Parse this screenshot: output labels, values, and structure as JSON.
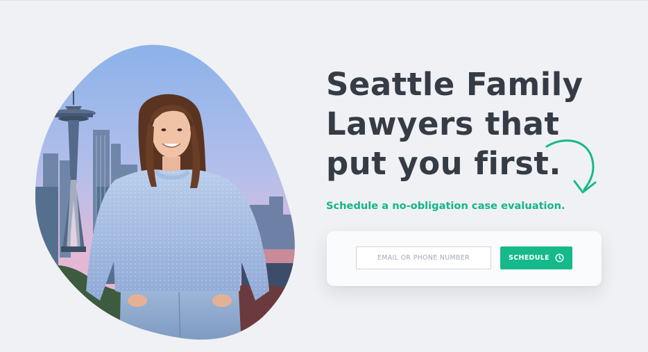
{
  "hero": {
    "headline_lines": [
      "Seattle Family",
      "Lawyers that",
      "put you first."
    ],
    "subheadline": "Schedule a no-obligation case evaluation.",
    "image_alt": "Smiling woman in a light blue knit sweater in front of the Seattle skyline and Space Needle"
  },
  "form": {
    "contact_placeholder": "EMAIL OR PHONE NUMBER",
    "contact_value": "",
    "schedule_label": "SCHEDULE",
    "schedule_icon": "clock-icon"
  },
  "colors": {
    "background": "#f0f1f4",
    "headline": "#363c45",
    "accent_green": "#13b688",
    "button_bg": "#15b98a",
    "card_bg": "#fafbfc"
  }
}
